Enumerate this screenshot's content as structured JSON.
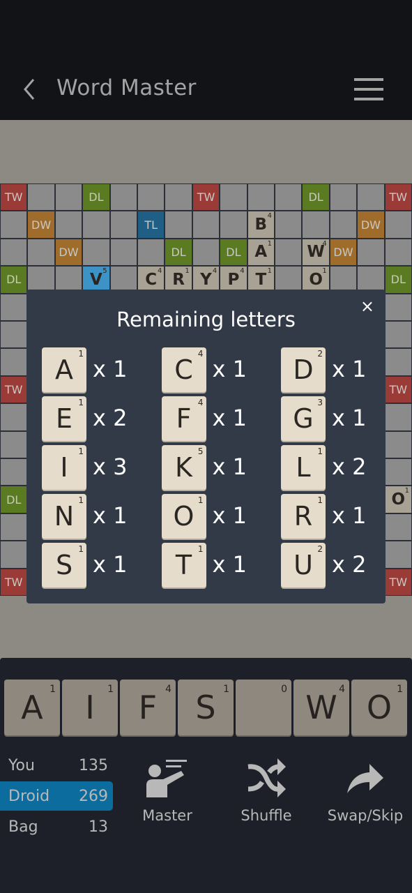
{
  "header": {
    "title": "Word Master",
    "icons": [
      "chevron-left-icon",
      "moon-icon",
      "hamburger-menu-icon"
    ]
  },
  "board": {
    "rows": [
      [
        "TW",
        "",
        "",
        "DL",
        "",
        "",
        "",
        "TW",
        "",
        "",
        "",
        "DL",
        "",
        "",
        "TW"
      ],
      [
        "",
        "DW",
        "",
        "",
        "",
        "TL",
        "",
        "",
        "",
        {
          "letter": "B",
          "value": "4"
        },
        "",
        "",
        "",
        "DW",
        ""
      ],
      [
        "",
        "",
        "DW",
        "",
        "",
        "",
        "DL",
        "",
        "DL",
        {
          "letter": "A",
          "value": "1"
        },
        "",
        {
          "letter": "W",
          "value": "4"
        },
        "DW",
        "",
        ""
      ],
      [
        "DL",
        "",
        "",
        {
          "letter": "V",
          "value": "5",
          "new": true
        },
        "",
        {
          "letter": "C",
          "value": "4"
        },
        {
          "letter": "R",
          "value": "1"
        },
        {
          "letter": "Y",
          "value": "4"
        },
        {
          "letter": "P",
          "value": "4"
        },
        {
          "letter": "T",
          "value": "1"
        },
        "",
        {
          "letter": "O",
          "value": "1"
        },
        "",
        "",
        "DL"
      ],
      [
        "",
        "",
        "",
        "",
        "",
        "",
        "",
        "",
        "",
        "",
        "",
        "",
        "",
        "",
        ""
      ],
      [
        "",
        "",
        "",
        "",
        "",
        "",
        "",
        "",
        "",
        "",
        "",
        "",
        "",
        "",
        ""
      ],
      [
        "",
        "",
        "",
        "",
        "",
        "",
        "",
        "",
        "",
        "",
        "",
        "",
        "",
        "",
        ""
      ],
      [
        "TW",
        "",
        "",
        "",
        "",
        "",
        "",
        "",
        "",
        "",
        "",
        "",
        "",
        "",
        "TW"
      ],
      [
        "",
        "",
        "",
        "",
        "",
        "",
        "",
        "",
        "",
        "",
        "",
        "",
        "",
        "",
        ""
      ],
      [
        "",
        "",
        "",
        "",
        "",
        "",
        "",
        "",
        "",
        "",
        "",
        "",
        "",
        "",
        ""
      ],
      [
        "",
        "",
        "",
        "",
        "",
        "",
        "",
        "",
        "",
        "",
        "",
        "",
        "",
        "",
        ""
      ],
      [
        "DL",
        "",
        "",
        "",
        "",
        "",
        "",
        "",
        "",
        "",
        "",
        "",
        "",
        "",
        {
          "letter": "O",
          "value": "1"
        }
      ],
      [
        "",
        "",
        "",
        "",
        "",
        "",
        "",
        "",
        "",
        "",
        "",
        "",
        "",
        "",
        ""
      ],
      [
        "",
        "",
        "",
        "",
        "",
        "",
        "",
        "",
        "",
        "",
        "",
        "",
        "",
        "",
        ""
      ],
      [
        "TW",
        "",
        "",
        "",
        "",
        "",
        "",
        "",
        "",
        "",
        "",
        "",
        "",
        "",
        "TW"
      ]
    ]
  },
  "modal": {
    "title": "Remaining letters",
    "close": "×",
    "letters": [
      {
        "letter": "A",
        "value": "1",
        "count": "x 1"
      },
      {
        "letter": "C",
        "value": "4",
        "count": "x 1"
      },
      {
        "letter": "D",
        "value": "2",
        "count": "x 1"
      },
      {
        "letter": "E",
        "value": "1",
        "count": "x 2"
      },
      {
        "letter": "F",
        "value": "4",
        "count": "x 1"
      },
      {
        "letter": "G",
        "value": "3",
        "count": "x 1"
      },
      {
        "letter": "I",
        "value": "1",
        "count": "x 3"
      },
      {
        "letter": "K",
        "value": "5",
        "count": "x 1"
      },
      {
        "letter": "L",
        "value": "1",
        "count": "x 2"
      },
      {
        "letter": "N",
        "value": "1",
        "count": "x 1"
      },
      {
        "letter": "O",
        "value": "1",
        "count": "x 1"
      },
      {
        "letter": "R",
        "value": "1",
        "count": "x 1"
      },
      {
        "letter": "S",
        "value": "1",
        "count": "x 1"
      },
      {
        "letter": "T",
        "value": "1",
        "count": "x 1"
      },
      {
        "letter": "U",
        "value": "2",
        "count": "x 2"
      }
    ]
  },
  "rack": [
    {
      "letter": "A",
      "value": "1"
    },
    {
      "letter": "I",
      "value": "1"
    },
    {
      "letter": "F",
      "value": "4"
    },
    {
      "letter": "S",
      "value": "1"
    },
    {
      "letter": "",
      "value": "0"
    },
    {
      "letter": "W",
      "value": "4"
    },
    {
      "letter": "O",
      "value": "1"
    }
  ],
  "scores": [
    {
      "label": "You",
      "value": "135"
    },
    {
      "label": "Droid",
      "value": "269",
      "active": true
    },
    {
      "label": "Bag",
      "value": "13"
    }
  ],
  "actions": [
    {
      "label": "Master",
      "icon": "teacher-icon"
    },
    {
      "label": "Shuffle",
      "icon": "shuffle-icon"
    },
    {
      "label": "Swap/Skip",
      "icon": "share-arrow-icon"
    }
  ],
  "colors": {
    "accent": "#0d6c9e",
    "TW": "#9b3b38",
    "DL": "#5b7b22",
    "DW": "#a06c2c",
    "TL": "#1f5f86"
  }
}
